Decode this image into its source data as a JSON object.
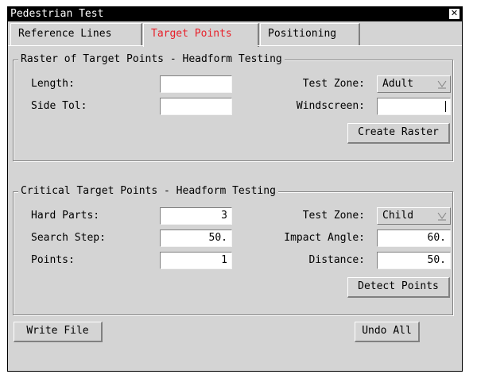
{
  "window": {
    "title": "Pedestrian Test",
    "close_glyph": "✕"
  },
  "tabs": [
    {
      "label": "Reference Lines"
    },
    {
      "label": "Target Points"
    },
    {
      "label": "Positioning"
    }
  ],
  "raster": {
    "title": "Raster of Target Points - Headform Testing",
    "length_label": "Length:",
    "length_value": "",
    "side_tol_label": "Side Tol:",
    "side_tol_value": "",
    "test_zone_label": "Test Zone:",
    "test_zone_value": "Adult",
    "windscreen_label": "Windscreen:",
    "windscreen_value": "",
    "create_button": "Create Raster"
  },
  "critical": {
    "title": "Critical Target Points - Headform Testing",
    "hard_parts_label": "Hard Parts:",
    "hard_parts_value": "3",
    "search_step_label": "Search Step:",
    "search_step_value": "50.",
    "points_label": "Points:",
    "points_value": "1",
    "test_zone_label": "Test Zone:",
    "test_zone_value": "Child",
    "impact_angle_label": "Impact Angle:",
    "impact_angle_value": "60.",
    "distance_label": "Distance:",
    "distance_value": "50.",
    "detect_button": "Detect Points"
  },
  "footer": {
    "write_button": "Write File",
    "undo_button": "Undo All"
  },
  "colors": {
    "active_tab": "#e8202a",
    "panel": "#d4d4d4"
  }
}
